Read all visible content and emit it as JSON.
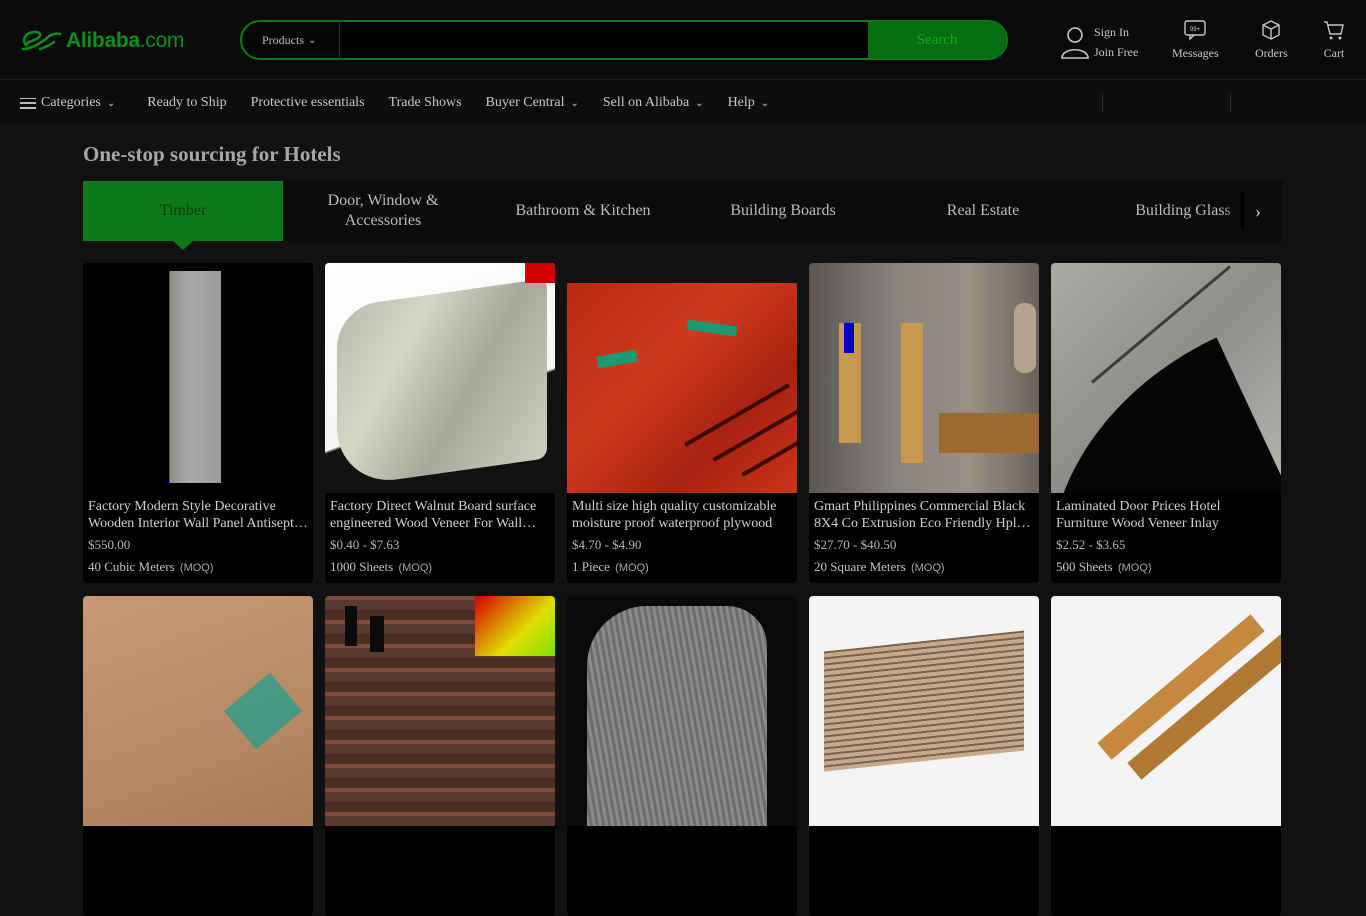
{
  "header": {
    "logo_text": "Alibaba",
    "logo_suffix": ".com",
    "search": {
      "category": "Products",
      "placeholder": "",
      "value": "",
      "button": "Search"
    },
    "signin": {
      "line1": "Sign In",
      "line2": "Join Free"
    },
    "messages": "Messages",
    "messages_badge": "99+",
    "orders": "Orders",
    "cart": "Cart"
  },
  "nav": {
    "categories": "Categories",
    "items": [
      "Ready to Ship",
      "Protective essentials",
      "Trade Shows",
      "Buyer Central",
      "Sell on Alibaba",
      "Help"
    ]
  },
  "main": {
    "title": "One-stop sourcing for Hotels",
    "tabs": [
      "Timber",
      "Door, Window & Accessories",
      "Bathroom & Kitchen",
      "Building Boards",
      "Real Estate",
      "Building Glass"
    ],
    "active_tab": 0,
    "products": [
      {
        "title": "Factory Modern Style Decorative Wooden Interior Wall Panel Antiseptic Wood",
        "price": "$550.00",
        "moq": "40 Cubic Meters",
        "moq_tag": "(MOQ)"
      },
      {
        "title": "Factory Direct Walnut Board surface engineered Wood Veneer For Wall Decoration",
        "price": "$0.40 - $7.63",
        "moq": "1000 Sheets",
        "moq_tag": "(MOQ)"
      },
      {
        "title": "Multi size high quality customizable moisture proof waterproof plywood",
        "price": "$4.70 - $4.90",
        "moq": "1 Piece",
        "moq_tag": "(MOQ)"
      },
      {
        "title": "Gmart Philippines Commercial Black 8X4 Co Extrusion Eco Friendly Hpl Board",
        "price": "$27.70 - $40.50",
        "moq": "20 Square Meters",
        "moq_tag": "(MOQ)"
      },
      {
        "title": "Laminated Door Prices Hotel Furniture Wood Veneer Inlay",
        "price": "$2.52 - $3.65",
        "moq": "500 Sheets",
        "moq_tag": "(MOQ)"
      },
      {
        "title": "",
        "price": "",
        "moq": "",
        "moq_tag": ""
      },
      {
        "title": "",
        "price": "",
        "moq": "",
        "moq_tag": ""
      },
      {
        "title": "",
        "price": "",
        "moq": "",
        "moq_tag": ""
      },
      {
        "title": "",
        "price": "",
        "moq": "",
        "moq_tag": ""
      },
      {
        "title": "",
        "price": "",
        "moq": "",
        "moq_tag": ""
      }
    ]
  },
  "colors": {
    "brand_green": "#0b8f1c",
    "active_tab_bg": "#0c7a18",
    "search_button_bg": "#066e10",
    "page_bg": "#111111",
    "card_bg": "#000000"
  },
  "icons": [
    "person-icon",
    "message-icon",
    "orders-icon",
    "cart-icon",
    "menu-icon",
    "chevron-down-icon",
    "chevron-right-icon"
  ]
}
